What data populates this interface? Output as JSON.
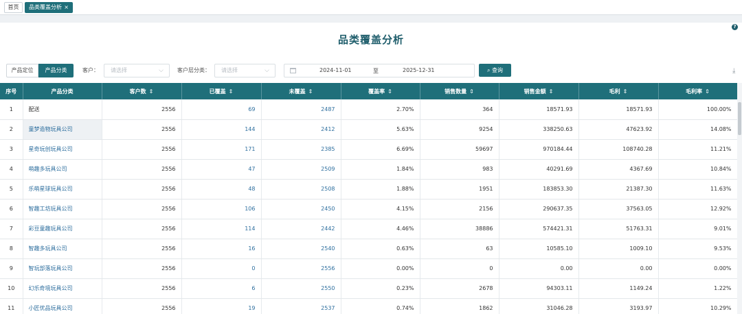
{
  "tabs": {
    "home": "首页",
    "active": "品类覆盖分析",
    "close": "×"
  },
  "page_title": "品类覆盖分析",
  "filters": {
    "seg_position": "产品定位",
    "seg_category": "产品分类",
    "customer_label": "客户：",
    "customer_placeholder": "请选择",
    "layer_label": "客户层分类：",
    "layer_placeholder": "请选择",
    "date_start": "2024-11-01",
    "date_sep": "至",
    "date_end": "2025-12-31",
    "query_label": "查询"
  },
  "table": {
    "headers": [
      "序号",
      "产品分类",
      "客户数",
      "已覆盖",
      "未覆盖",
      "覆盖率",
      "销售数量",
      "销售金额",
      "毛利",
      "毛利率"
    ],
    "rows": [
      [
        "1",
        "配送",
        "2556",
        "69",
        "2487",
        "2.70%",
        "364",
        "18571.93",
        "18571.93",
        "100.00%"
      ],
      [
        "2",
        "童梦造物玩具公司",
        "2556",
        "144",
        "2412",
        "5.63%",
        "9254",
        "338250.63",
        "47623.92",
        "14.08%"
      ],
      [
        "3",
        "星奇玩创玩具公司",
        "2556",
        "171",
        "2385",
        "6.69%",
        "59697",
        "970184.44",
        "108740.28",
        "11.21%"
      ],
      [
        "4",
        "萌趣多玩具公司",
        "2556",
        "47",
        "2509",
        "1.84%",
        "983",
        "40291.69",
        "4367.69",
        "10.84%"
      ],
      [
        "5",
        "乐萌星球玩具公司",
        "2556",
        "48",
        "2508",
        "1.88%",
        "1951",
        "183853.30",
        "21387.30",
        "11.63%"
      ],
      [
        "6",
        "智趣工坊玩具公司",
        "2556",
        "106",
        "2450",
        "4.15%",
        "2156",
        "290637.35",
        "37563.05",
        "12.92%"
      ],
      [
        "7",
        "彩豆童趣玩具公司",
        "2556",
        "114",
        "2442",
        "4.46%",
        "38886",
        "574421.31",
        "51763.31",
        "9.01%"
      ],
      [
        "8",
        "智趣多玩具公司",
        "2556",
        "16",
        "2540",
        "0.63%",
        "63",
        "10585.10",
        "1009.10",
        "9.53%"
      ],
      [
        "9",
        "智玩部落玩具公司",
        "2556",
        "0",
        "2556",
        "0.00%",
        "0",
        "0.00",
        "0.00",
        "0.00%"
      ],
      [
        "10",
        "幻乐奇境玩具公司",
        "2556",
        "6",
        "2550",
        "0.23%",
        "2678",
        "94303.11",
        "1149.24",
        "1.22%"
      ],
      [
        "11",
        "小匠优品玩具公司",
        "2556",
        "19",
        "2537",
        "0.74%",
        "1862",
        "31046.28",
        "3193.97",
        "10.29%"
      ]
    ]
  }
}
